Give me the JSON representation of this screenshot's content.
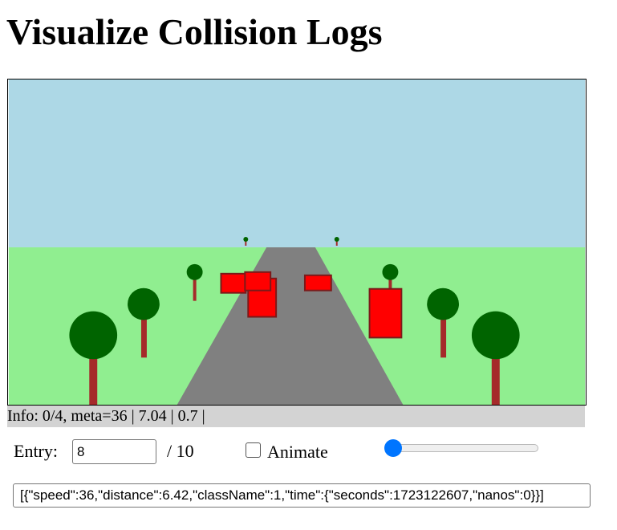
{
  "page": {
    "title": "Visualize Collision Logs"
  },
  "scene": {
    "sky_color": "#add8e6",
    "grass_color": "#90ee90",
    "road_color": "#808080",
    "tree_trunk_color": "#a52a2a",
    "tree_foliage_color": "#006400",
    "obstacle_color": "#ff0000"
  },
  "info": {
    "text": "Info: 0/4, meta=36 | 7.04 | 0.7 |"
  },
  "controls": {
    "entry_label": "Entry:",
    "entry_value": "8",
    "entry_total": "/ 10",
    "animate_label": "Animate",
    "animate_checked": false,
    "slider_level": 0.03
  },
  "json_text": "[{\"speed\":36,\"distance\":6.42,\"className\":1,\"time\":{\"seconds\":1723122607,\"nanos\":0}}]"
}
